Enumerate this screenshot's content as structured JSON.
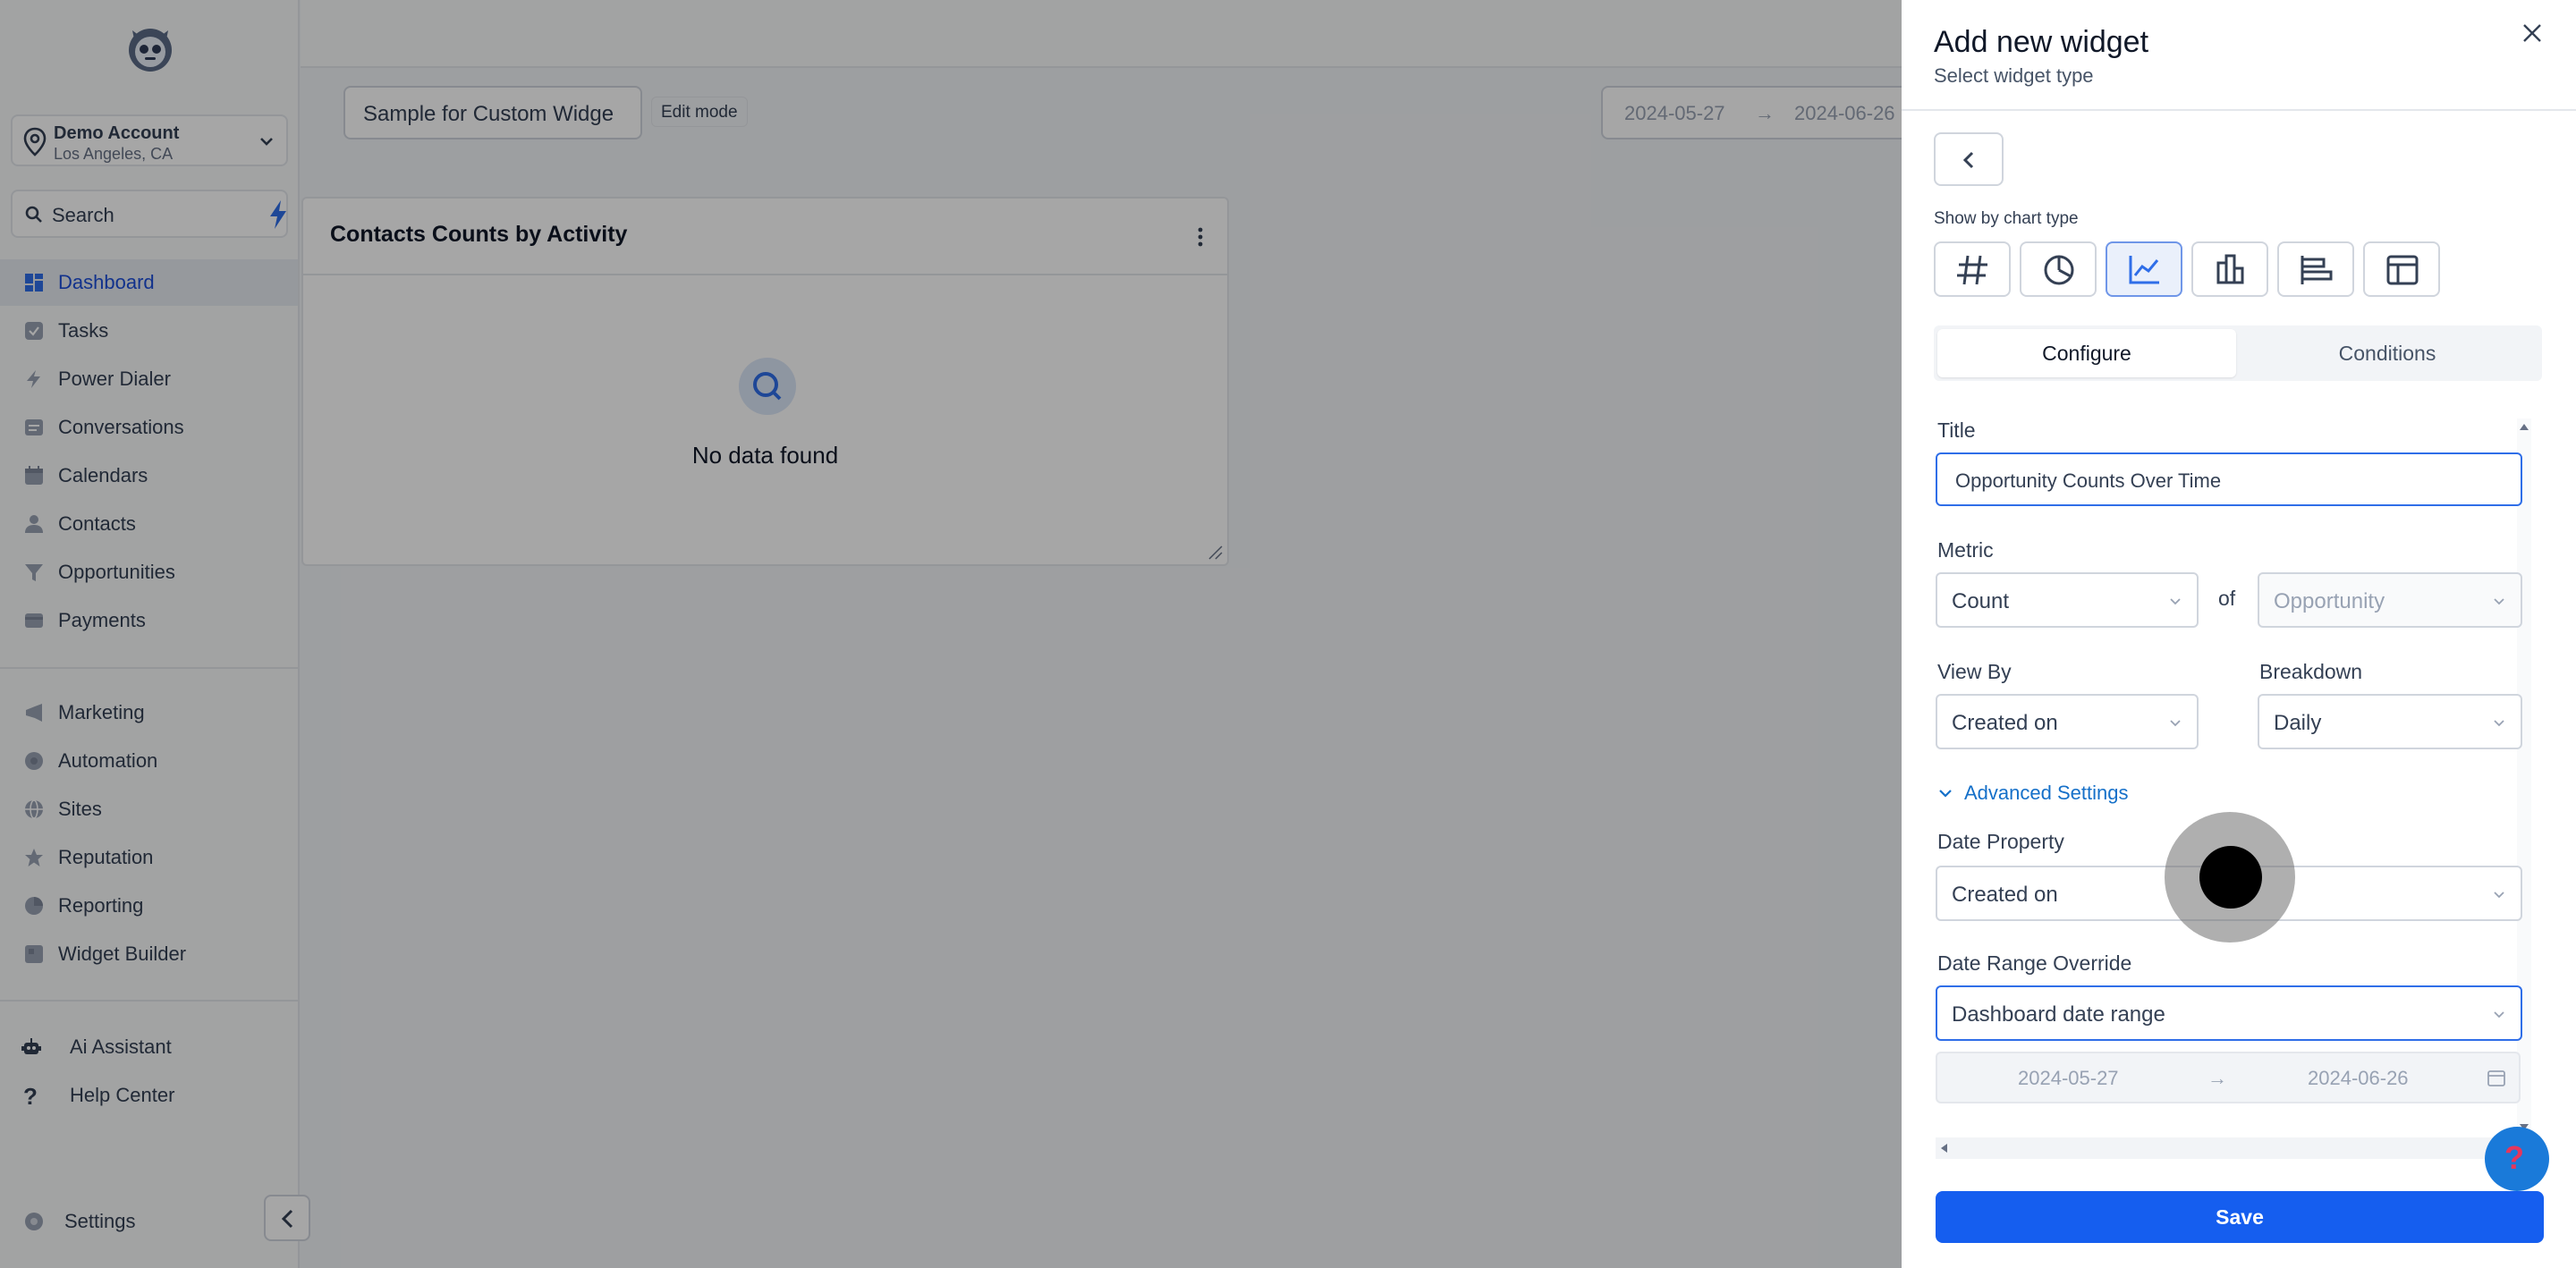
{
  "sidebar": {
    "account": {
      "name": "Demo Account",
      "location": "Los Angeles, CA"
    },
    "search_placeholder": "Search",
    "items": [
      {
        "label": "Dashboard",
        "icon": "dashboard-icon",
        "active": true
      },
      {
        "label": "Tasks",
        "icon": "check-icon"
      },
      {
        "label": "Power Dialer",
        "icon": "bolt-icon"
      },
      {
        "label": "Conversations",
        "icon": "chat-icon"
      },
      {
        "label": "Calendars",
        "icon": "calendar-icon"
      },
      {
        "label": "Contacts",
        "icon": "person-icon"
      },
      {
        "label": "Opportunities",
        "icon": "funnel-icon"
      },
      {
        "label": "Payments",
        "icon": "card-icon"
      }
    ],
    "items2": [
      {
        "label": "Marketing",
        "icon": "megaphone-icon"
      },
      {
        "label": "Automation",
        "icon": "automation-icon"
      },
      {
        "label": "Sites",
        "icon": "globe-icon"
      },
      {
        "label": "Reputation",
        "icon": "star-icon"
      },
      {
        "label": "Reporting",
        "icon": "pie-icon"
      },
      {
        "label": "Widget Builder",
        "icon": "widget-icon"
      }
    ],
    "items3": [
      {
        "label": "Ai Assistant",
        "icon": "robot-icon"
      },
      {
        "label": "Help Center",
        "icon": "question-icon"
      }
    ],
    "settings_label": "Settings"
  },
  "main": {
    "dashboard_name": "Sample for Custom Widge",
    "edit_mode": "Edit mode",
    "date_from": "2024-05-27",
    "date_arrow": "→",
    "date_to": "2024-06-26",
    "card": {
      "title": "Contacts Counts by Activity",
      "empty": "No data found"
    }
  },
  "drawer": {
    "title": "Add new widget",
    "subtitle": "Select widget type",
    "chart_type_label": "Show by chart type",
    "chart_types": [
      "number",
      "pie",
      "line",
      "bar",
      "horizontal-bar",
      "table"
    ],
    "selected_chart_type": "line",
    "tabs": {
      "configure": "Configure",
      "conditions": "Conditions"
    },
    "title_label": "Title",
    "title_value": "Opportunity Counts Over Time",
    "metric_label": "Metric",
    "metric_value": "Count",
    "of_label": "of",
    "metric_object": "Opportunity",
    "view_by_label": "View By",
    "view_by_value": "Created on",
    "breakdown_label": "Breakdown",
    "breakdown_value": "Daily",
    "advanced_label": "Advanced Settings",
    "date_property_label": "Date Property",
    "date_property_value": "Created on",
    "date_range_label": "Date Range Override",
    "date_range_value": "Dashboard date range",
    "range_from": "2024-05-27",
    "range_arrow": "→",
    "range_to": "2024-06-26",
    "save": "Save",
    "help_glyph": "?"
  },
  "colors": {
    "primary": "#155eef",
    "link": "#1570c9",
    "overlay": "rgba(0,0,0,0.35)"
  }
}
